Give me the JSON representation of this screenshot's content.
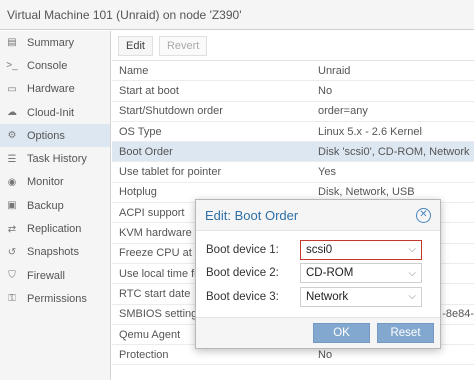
{
  "window": {
    "title": "Virtual Machine 101 (Unraid) on node 'Z390'"
  },
  "sidebar": {
    "items": [
      {
        "label": "Summary",
        "icon": "summary-icon",
        "glyph": "▤"
      },
      {
        "label": "Console",
        "icon": "console-icon",
        "glyph": ">_"
      },
      {
        "label": "Hardware",
        "icon": "hardware-icon",
        "glyph": "▭"
      },
      {
        "label": "Cloud-Init",
        "icon": "cloud-icon",
        "glyph": "☁"
      },
      {
        "label": "Options",
        "icon": "gear-icon",
        "glyph": "⚙",
        "active": true
      },
      {
        "label": "Task History",
        "icon": "list-icon",
        "glyph": "☰"
      },
      {
        "label": "Monitor",
        "icon": "eye-icon",
        "glyph": "◉"
      },
      {
        "label": "Backup",
        "icon": "save-icon",
        "glyph": "▣"
      },
      {
        "label": "Replication",
        "icon": "retweet-icon",
        "glyph": "⇄"
      },
      {
        "label": "Snapshots",
        "icon": "history-icon",
        "glyph": "↺"
      },
      {
        "label": "Firewall",
        "icon": "shield-icon",
        "glyph": "⛉"
      },
      {
        "label": "Permissions",
        "icon": "unlock-icon",
        "glyph": "⚿"
      }
    ]
  },
  "toolbar": {
    "edit_label": "Edit",
    "revert_label": "Revert"
  },
  "options": {
    "rows": [
      {
        "key": "Name",
        "value": "Unraid"
      },
      {
        "key": "Start at boot",
        "value": "No"
      },
      {
        "key": "Start/Shutdown order",
        "value": "order=any"
      },
      {
        "key": "OS Type",
        "value": "Linux 5.x - 2.6 Kernel"
      },
      {
        "key": "Boot Order",
        "value": "Disk 'scsi0', CD-ROM, Network",
        "selected": true
      },
      {
        "key": "Use tablet for pointer",
        "value": "Yes"
      },
      {
        "key": "Hotplug",
        "value": "Disk, Network, USB"
      },
      {
        "key": "ACPI support",
        "value": ""
      },
      {
        "key": "KVM hardware v",
        "value": ""
      },
      {
        "key": "Freeze CPU at s",
        "value": ""
      },
      {
        "key": "Use local time fo",
        "value": ""
      },
      {
        "key": "RTC start date",
        "value": ""
      },
      {
        "key": "SMBIOS setting",
        "value": "-8e84-"
      },
      {
        "key": "Qemu Agent",
        "value": ""
      },
      {
        "key": "Protection",
        "value": "No"
      }
    ]
  },
  "dialog": {
    "title": "Edit: Boot Order",
    "fields": [
      {
        "label": "Boot device 1:",
        "value": "scsi0",
        "invalid": true
      },
      {
        "label": "Boot device 2:",
        "value": "CD-ROM"
      },
      {
        "label": "Boot device 3:",
        "value": "Network"
      }
    ],
    "ok_label": "OK",
    "reset_label": "Reset",
    "accent_color": "#2f6fa6",
    "button_color": "#83a8d0",
    "invalid_color": "#c0392b"
  }
}
